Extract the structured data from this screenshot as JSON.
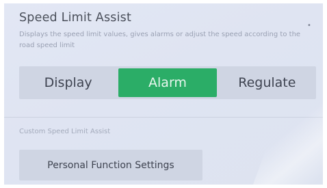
{
  "setting": {
    "title": "Speed Limit Assist",
    "description": "Displays the speed limit values, gives alarms or adjust the speed according to the road speed limit",
    "info_icon": "info-dot-icon"
  },
  "mode_selector": {
    "options": [
      {
        "label": "Display",
        "selected": false
      },
      {
        "label": "Alarm",
        "selected": true
      },
      {
        "label": "Regulate",
        "selected": false
      }
    ],
    "active_color": "#2bad67"
  },
  "custom_section": {
    "label": "Custom Speed Limit Assist",
    "button_label": "Personal Function Settings"
  }
}
